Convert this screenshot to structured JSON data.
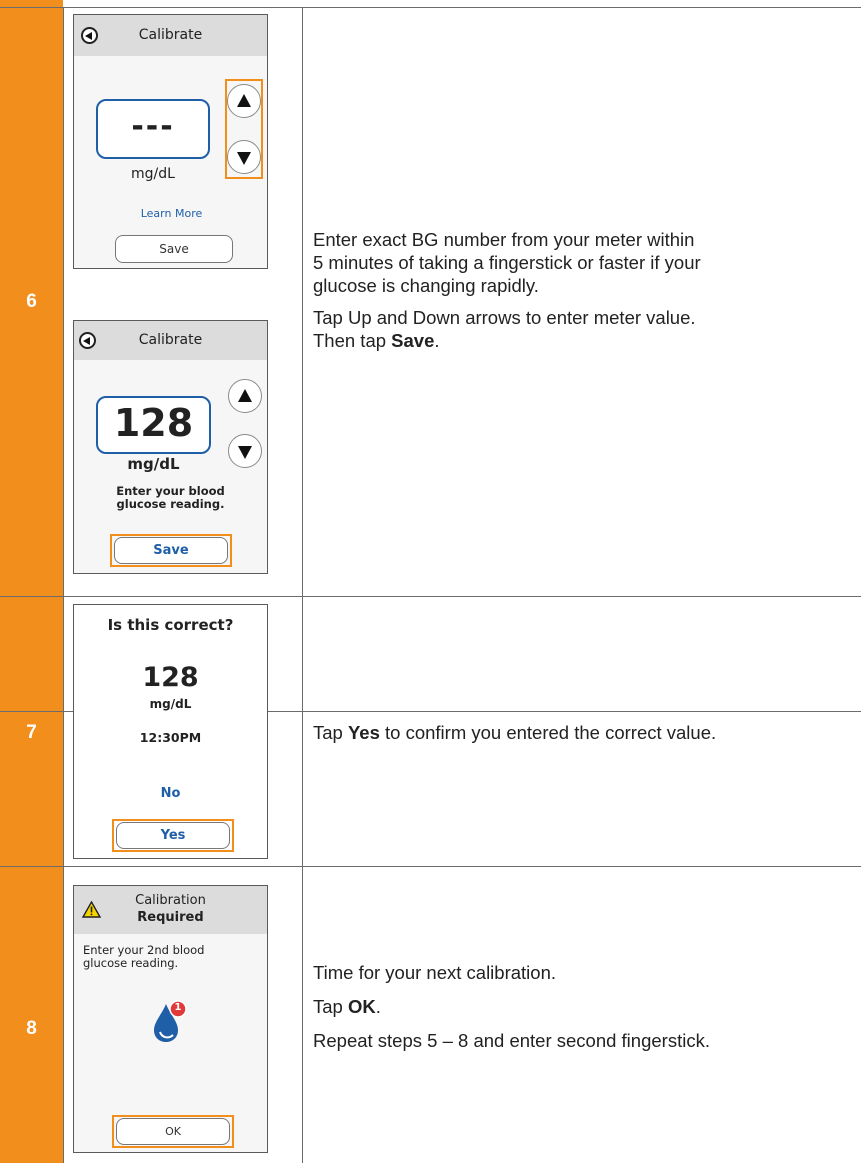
{
  "rows": [
    {
      "step": "6",
      "screen_a": {
        "title": "Calibrate",
        "value": "---",
        "unit": "mg/dL",
        "learn_more": "Learn More",
        "save": "Save"
      },
      "screen_b": {
        "title": "Calibrate",
        "value": "128",
        "unit": "mg/dL",
        "prompt_line1": "Enter your blood",
        "prompt_line2": "glucose reading.",
        "save": "Save"
      },
      "instructions": {
        "p1_line1": "Enter exact BG number from your meter within",
        "p1_line2": "5 minutes of taking a fingerstick or faster if your",
        "p1_line3": "glucose is changing rapidly.",
        "p2_line1": "Tap Up and Down arrows to enter meter value.",
        "p2_line2_pre": "Then tap ",
        "p2_line2_bold": "Save",
        "p2_line2_post": "."
      }
    },
    {
      "step": "7",
      "screen": {
        "title": "Is this correct?",
        "value": "128",
        "unit": "mg/dL",
        "time": "12:30PM",
        "no": "No",
        "yes": "Yes"
      },
      "instructions": {
        "pre": "Tap ",
        "bold": "Yes",
        "post": " to confirm you entered the correct value."
      }
    },
    {
      "step": "8",
      "screen": {
        "title_line1": "Calibration",
        "title_line2": "Required",
        "message_line1": "Enter your 2nd blood",
        "message_line2": "glucose reading.",
        "badge": "1",
        "ok": "OK"
      },
      "instructions": {
        "p1": "Time for your next calibration.",
        "p2_pre": "Tap ",
        "p2_bold": "OK",
        "p2_post": ".",
        "p3": "Repeat steps 5 – 8 and enter second fingerstick."
      }
    }
  ],
  "colors": {
    "accent_orange": "#f18e1c",
    "link_blue": "#1f5fa8",
    "screen_bg": "#f6f6f6",
    "header_gray": "#dcdcdc"
  }
}
